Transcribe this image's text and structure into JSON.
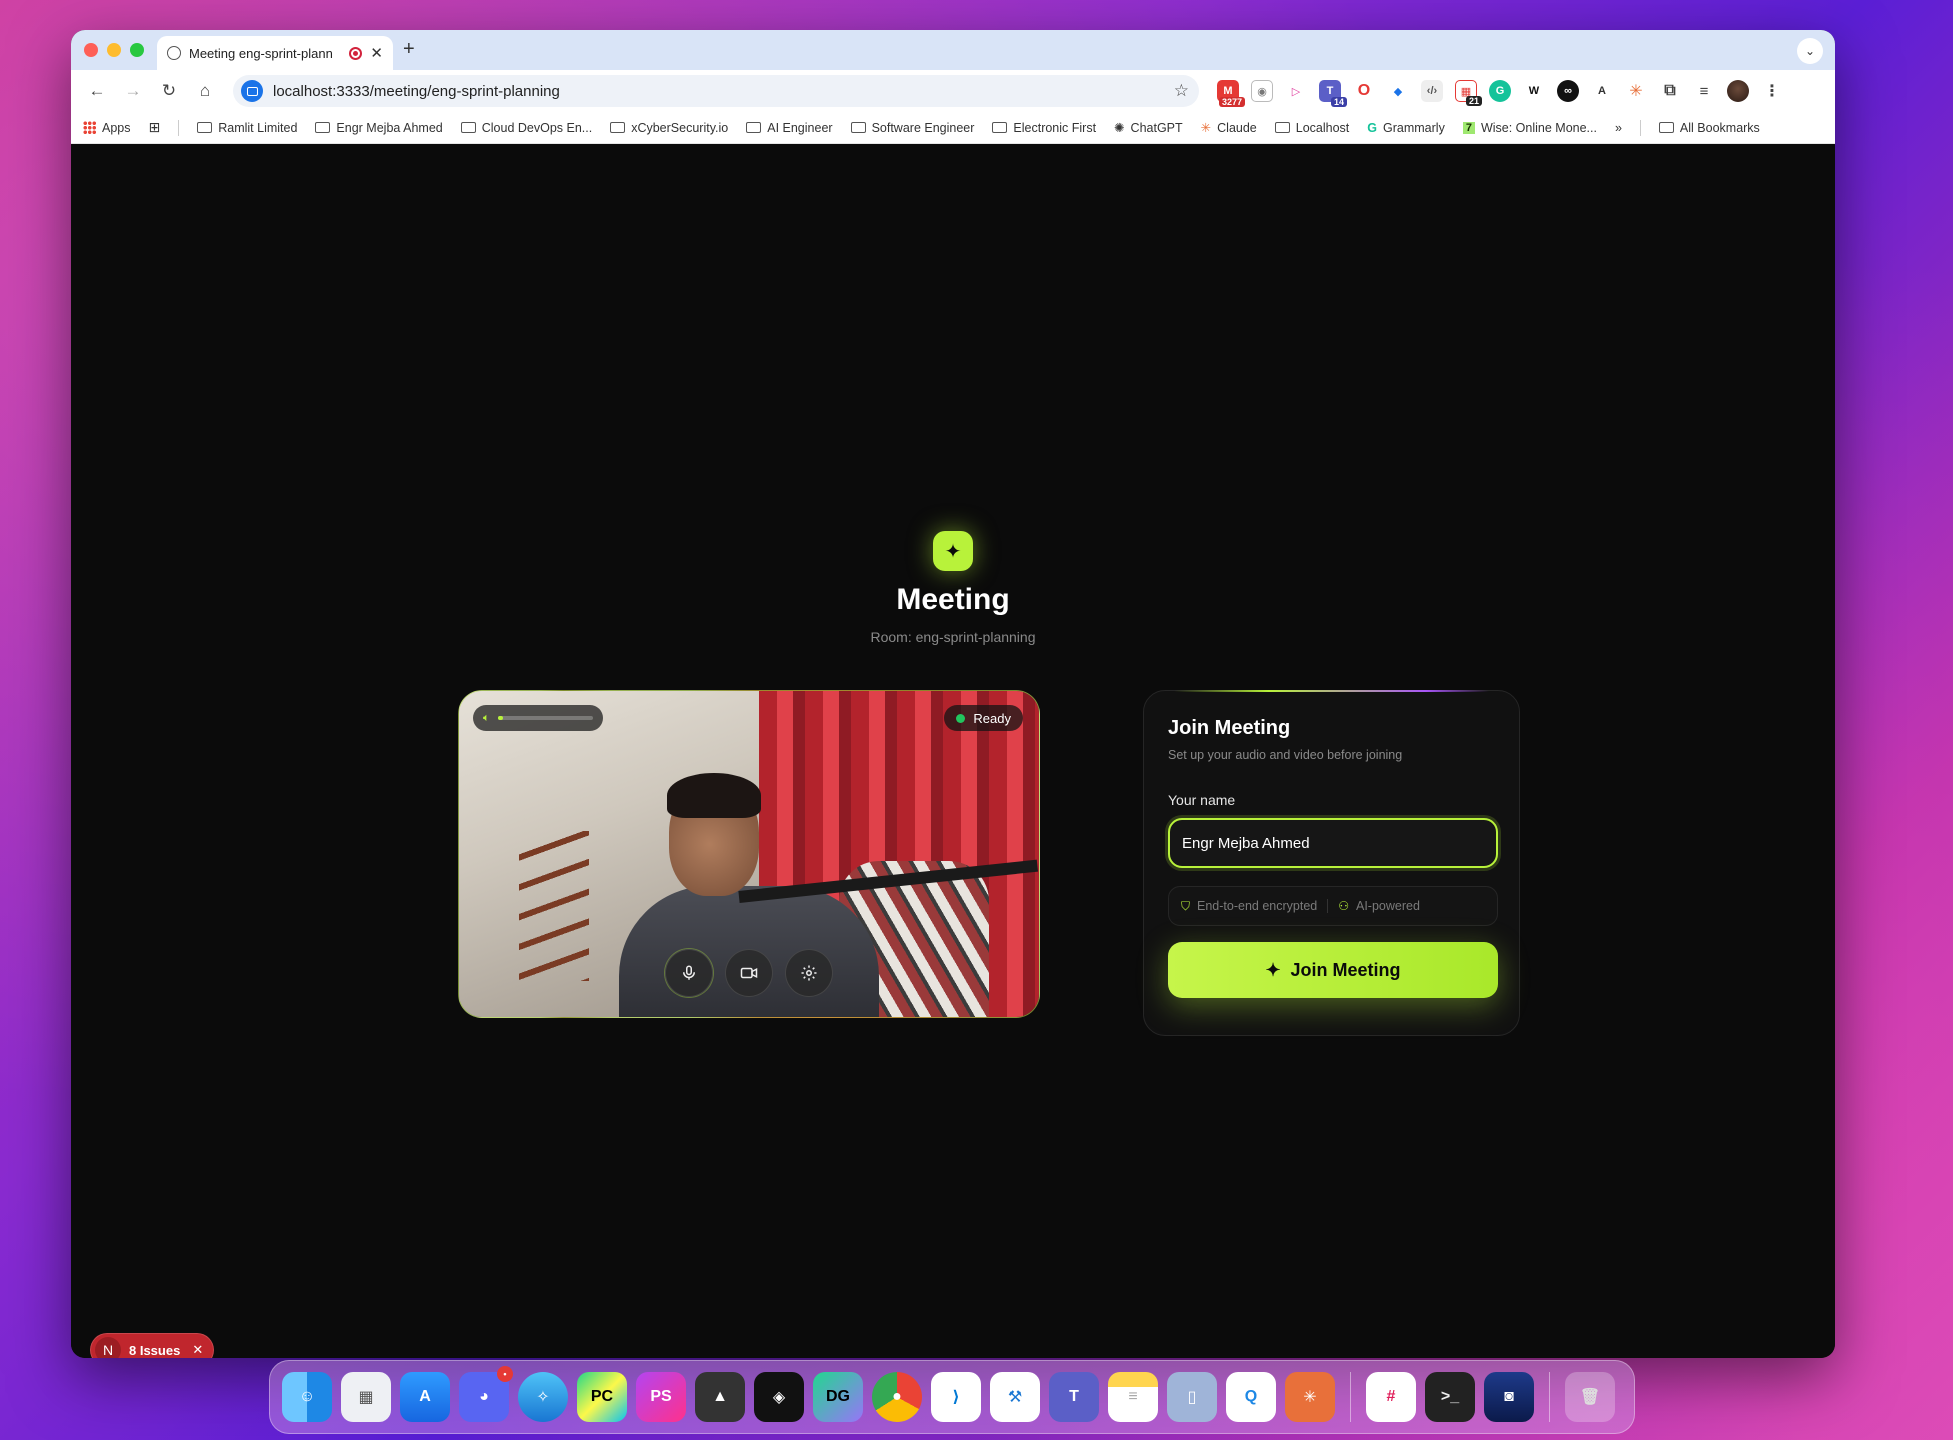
{
  "browser": {
    "tab": {
      "title": "Meeting eng-sprint-plann"
    },
    "url": "localhost:3333/meeting/eng-sprint-planning",
    "extension_badges": {
      "gmail": "3277",
      "teams": "14",
      "calendar": "21"
    },
    "bookmarks": [
      {
        "label": "Apps",
        "kind": "apps"
      },
      {
        "label": "Ramlit Limited",
        "kind": "folder"
      },
      {
        "label": "Engr Mejba Ahmed",
        "kind": "folder"
      },
      {
        "label": "Cloud DevOps En...",
        "kind": "folder"
      },
      {
        "label": "xCyberSecurity.io",
        "kind": "folder"
      },
      {
        "label": "AI Engineer",
        "kind": "folder"
      },
      {
        "label": "Software Engineer",
        "kind": "folder"
      },
      {
        "label": "Electronic First",
        "kind": "folder"
      },
      {
        "label": "ChatGPT",
        "kind": "site"
      },
      {
        "label": "Claude",
        "kind": "site"
      },
      {
        "label": "Localhost",
        "kind": "folder"
      },
      {
        "label": "Grammarly",
        "kind": "site"
      },
      {
        "label": "Wise: Online Mone...",
        "kind": "site"
      }
    ],
    "more_bookmarks": "»",
    "all_bookmarks": "All Bookmarks"
  },
  "page": {
    "title": "Meeting",
    "room": "Room: eng-sprint-planning",
    "video": {
      "status": "Ready",
      "audio_level": 0.05,
      "controls": [
        "mic-icon",
        "camera-icon",
        "settings-icon"
      ]
    },
    "join": {
      "title": "Join Meeting",
      "subtitle": "Set up your audio and video before joining",
      "name_label": "Your name",
      "name_value": "Engr Mejba Ahmed",
      "features": [
        "End-to-end encrypted",
        "AI-powered"
      ],
      "button": "Join Meeting"
    },
    "issues": {
      "avatar": "N",
      "label": "8 Issues"
    }
  },
  "colors": {
    "accent": "#b8f23a",
    "background": "#0b0b0b",
    "ready_dot": "#22c55e",
    "issues": "#c0262d"
  },
  "dock": {
    "discord_badge": "•",
    "apps": [
      "Finder",
      "Launchpad",
      "App Store",
      "Discord",
      "Safari",
      "PyCharm",
      "PhpStorm",
      "Altair",
      "Unity",
      "DataGrip",
      "Chrome",
      "VS Code",
      "Xcode Instruments",
      "Teams",
      "Notes",
      "Simulator",
      "Proxyman",
      "Claude",
      "Slack",
      "Terminal",
      "Finder Helper",
      "Trash"
    ]
  }
}
